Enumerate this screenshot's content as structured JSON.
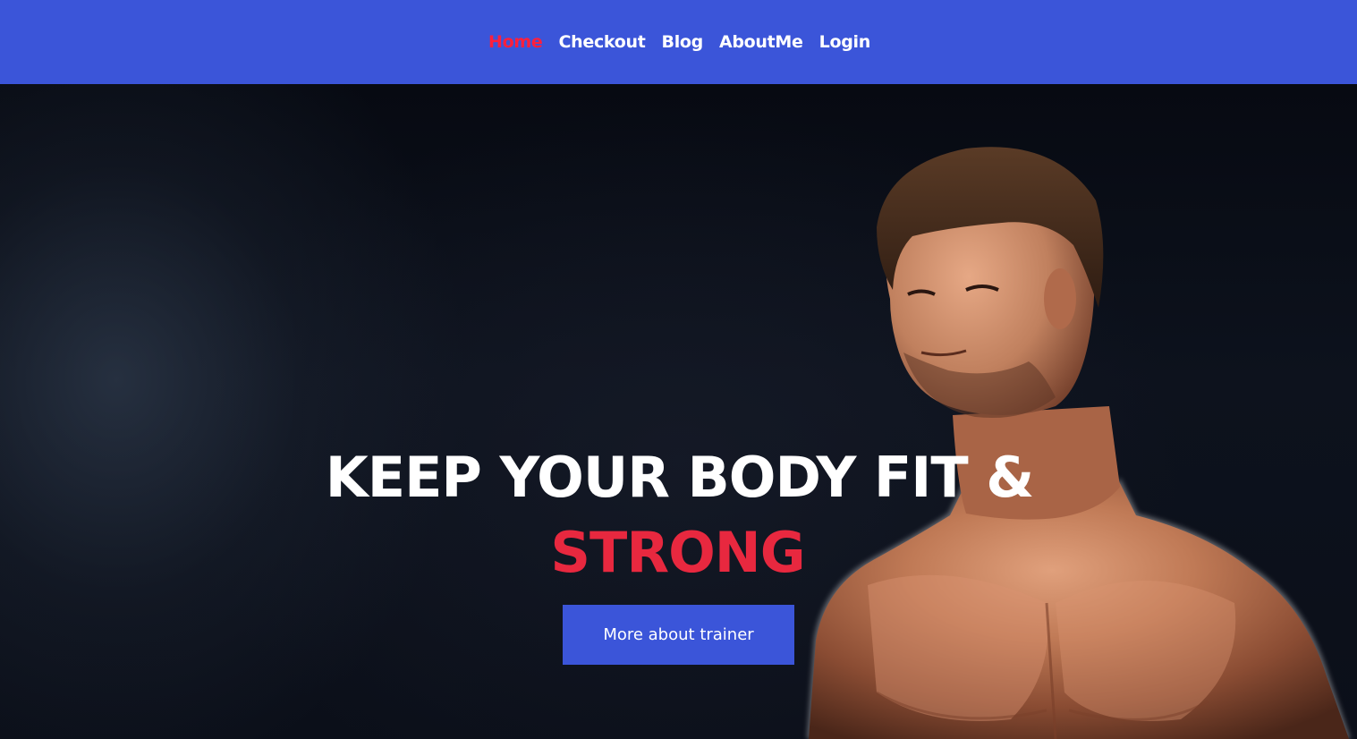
{
  "nav": {
    "items": [
      {
        "label": "Home",
        "active": true
      },
      {
        "label": "Checkout",
        "active": false
      },
      {
        "label": "Blog",
        "active": false
      },
      {
        "label": "AboutMe",
        "active": false
      },
      {
        "label": "Login",
        "active": false
      }
    ]
  },
  "hero": {
    "title_line1": "KEEP YOUR BODY FIT &",
    "title_line2": "STRONG",
    "cta_label": "More about trainer"
  },
  "colors": {
    "nav_background": "#3b55d9",
    "active_link": "#ff1f3d",
    "accent_red": "#e8283f",
    "button_background": "#3b55d9",
    "hero_background": "#0b0f19"
  }
}
